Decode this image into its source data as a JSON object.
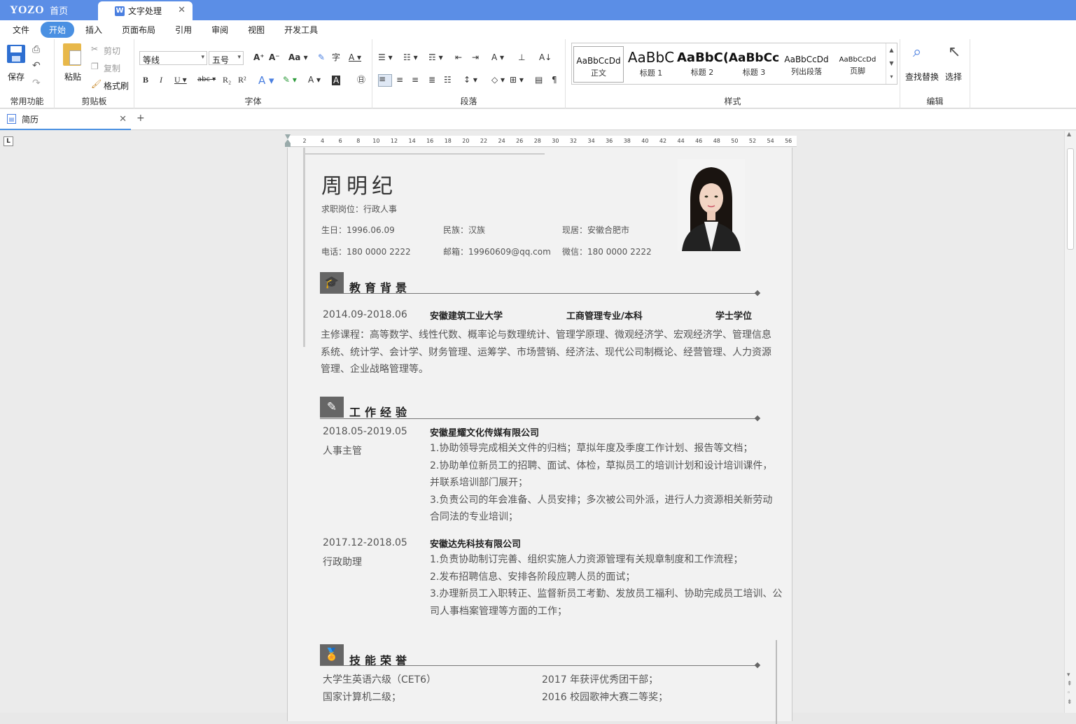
{
  "titlebar": {
    "logo": "YOZO",
    "home": "首页",
    "doc_tab": "文字处理",
    "doc_tab_icon": "W"
  },
  "menu": [
    "文件",
    "开始",
    "插入",
    "页面布局",
    "引用",
    "审阅",
    "视图",
    "开发工具"
  ],
  "ribbon": {
    "common": {
      "save": "保存",
      "label": "常用功能"
    },
    "clipboard": {
      "paste": "粘贴",
      "cut": "剪切",
      "copy": "复制",
      "format_painter": "格式刷",
      "label": "剪贴板"
    },
    "font": {
      "font_name": "等线",
      "font_size": "五号",
      "label": "字体"
    },
    "paragraph": {
      "label": "段落"
    },
    "styles": {
      "label": "样式",
      "items": [
        {
          "preview": "AaBbCcDd",
          "name": "正文"
        },
        {
          "preview": "AaBbC",
          "name": "标题 1"
        },
        {
          "preview": "AaBbC(",
          "name": "标题 2"
        },
        {
          "preview": "AaBbCc",
          "name": "标题 3"
        },
        {
          "preview": "AaBbCcDd",
          "name": "列出段落"
        },
        {
          "preview": "AaBbCcDd",
          "name": "页脚"
        }
      ]
    },
    "edit": {
      "find_replace": "查找替换",
      "select": "选择",
      "label": "编辑"
    }
  },
  "file_tab": {
    "name": "简历",
    "plus": "+"
  },
  "ruler": [
    "2",
    "4",
    "6",
    "8",
    "10",
    "12",
    "14",
    "16",
    "18",
    "20",
    "22",
    "24",
    "26",
    "28",
    "30",
    "32",
    "34",
    "36",
    "38",
    "40",
    "42",
    "44",
    "46",
    "48",
    "50",
    "52",
    "54",
    "56"
  ],
  "resume": {
    "name": "周明纪",
    "position": "求职岗位：行政人事",
    "birth": "生日：1996.06.09",
    "ethnicity": "民族：汉族",
    "residence": "现居：安徽合肥市",
    "phone": "电话：180 0000 2222",
    "email": "邮箱：19960609@qq.com",
    "wechat": "微信：180 0000 2222",
    "education": {
      "title": "教育背景",
      "period": "2014.09-2018.06",
      "school": "安徽建筑工业大学",
      "major": "工商管理专业/本科",
      "degree": "学士学位",
      "courses": [
        "主修课程：高等数学、线性代数、概率论与数理统计、管理学原理、微观经济学、宏观经济学、管理信息",
        "系统、统计学、会计学、财务管理、运筹学、市场营销、经济法、现代公司制概论、经营管理、人力资源",
        "管理、企业战略管理等。"
      ]
    },
    "work": {
      "title": "工作经验",
      "jobs": [
        {
          "period": "2018.05-2019.05",
          "role": "人事主管",
          "company": "安徽星耀文化传媒有限公司",
          "lines": [
            "1.协助领导完成相关文件的归档；草拟年度及季度工作计划、报告等文档；",
            "2.协助单位新员工的招聘、面试、体检，草拟员工的培训计划和设计培训课件，",
            "并联系培训部门展开；",
            "3.负责公司的年会准备、人员安排；多次被公司外派，进行人力资源相关新劳动",
            "合同法的专业培训；"
          ]
        },
        {
          "period": "2017.12-2018.05",
          "role": "行政助理",
          "company": "安徽达先科技有限公司",
          "lines": [
            "1.负责协助制订完善、组织实施人力资源管理有关规章制度和工作流程；",
            "2.发布招聘信息、安排各阶段应聘人员的面试；",
            "3.办理新员工入职转正、监督新员工考勤、发放员工福利、协助完成员工培训、公",
            "司人事档案管理等方面的工作；"
          ]
        }
      ]
    },
    "skills": {
      "title": "技能荣誉",
      "left": [
        "大学生英语六级（CET6）",
        "国家计算机二级；"
      ],
      "right": [
        "2017 年获评优秀团干部；",
        "2016 校园歌神大赛二等奖；"
      ]
    }
  }
}
